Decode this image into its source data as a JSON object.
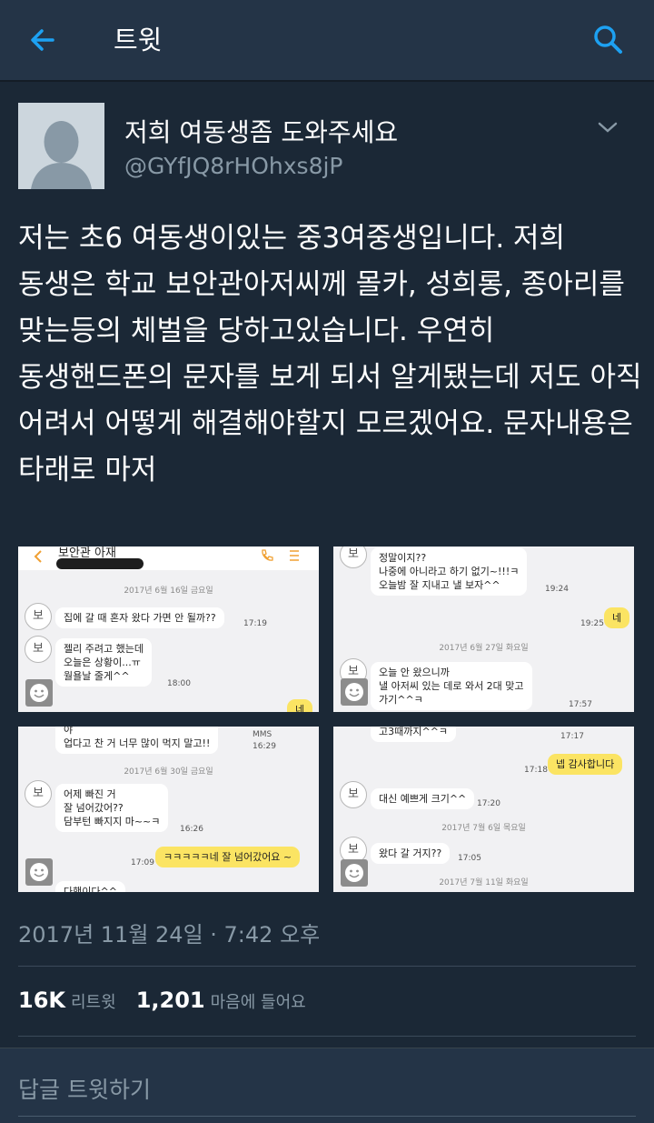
{
  "header": {
    "title": "트윗",
    "back_icon": "back-arrow-icon",
    "search_icon": "search-icon",
    "accent_color": "#1da1f2"
  },
  "tweet": {
    "display_name": "저희 여동생좀 도와주세요",
    "handle": "@GYfJQ8rHOhxs8jP",
    "text": "저는 초6 여동생이있는 중3여중생입니다. 저희 동생은 학교 보안관아저씨께 몰카, 성희롱, 종아리를 맞는등의 체벌을 당하고있습니다. 우연히 동생핸드폰의 문자를 보게 되서 알게됐는데 저도 아직 어려서 어떻게 해결해야할지 모르겠어요. 문자내용은 타래로 마저",
    "timestamp": "2017년 11월 24일 · 7:42 오후",
    "retweets": "16K",
    "retweets_label": "리트윗",
    "likes": "1,201",
    "likes_label": "마음에 들어요"
  },
  "media": {
    "image1": {
      "contact": "보안관 아재",
      "date": "2017년 6월 16일 금요일",
      "sender_badge": "보",
      "msg1": "집에 갈 때 혼자 왔다 가면 안 될까??",
      "msg1_time": "17:19",
      "msg2_line1": "젤리 주려고 했는데",
      "msg2_line2": "오늘은 상황이...ㅠ",
      "msg2_line3": "월욜날 줄게^^",
      "msg2_time": "18:00",
      "reply_partial": "네"
    },
    "image2": {
      "sender_badge": "보",
      "msg1_line1": "정말이지??",
      "msg1_line2": "나중에 아니라고 하기 없기~!!!ㅋ",
      "msg1_line3": "오늘밤 잘 지내고 낼 보자^^",
      "msg1_time": "19:24",
      "reply": "네",
      "reply_time": "19:25",
      "date": "2017년 6월 27일 화요일",
      "msg2_line1": "오늘 안 왔으니까",
      "msg2_line2": "낼 아저씨 있는 데로 와서 2대 맞고",
      "msg2_line3": "가기^^ㅋ",
      "msg2_time": "17:57"
    },
    "image3": {
      "top_partial": "업다고 찬 거 너무 많이 먹지 말고!!",
      "top_partial_prefix": "야",
      "mms": "MMS",
      "mms_time": "16:29",
      "date": "2017년 6월 30일 금요일",
      "sender_badge": "보",
      "msg1_line1": "어제 빠진 거",
      "msg1_line2": "잘 넘어갔어??",
      "msg1_line3": "담부턴 빠지지 마~~ㅋ",
      "msg1_time": "16:26",
      "reply": "ㅋㅋㅋㅋㅋ네 잘 넘어갔어요 ~",
      "reply_time": "17:09",
      "bottom_partial": "다행이다^^"
    },
    "image4": {
      "top_partial": "고3때까지^^ㅋ",
      "top_time": "17:17",
      "reply": "넵 감사합니다",
      "reply_time": "17:18",
      "sender_badge": "보",
      "msg1": "대신 예쁘게 크기^^",
      "msg1_time": "17:20",
      "date1": "2017년 7월 6일 목요일",
      "msg2": "왔다 갈 거지??",
      "msg2_time": "17:05",
      "date2": "2017년 7월 11일 화요일"
    }
  },
  "reply_box": {
    "placeholder": "답글 트윗하기"
  }
}
